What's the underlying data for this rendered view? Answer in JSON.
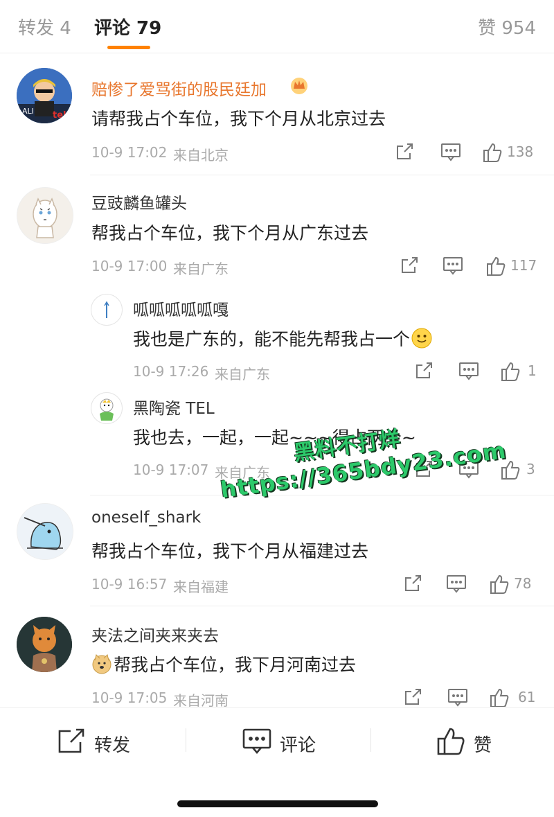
{
  "tabs": {
    "repost": "转发 4",
    "comments": "评论 79",
    "likes": "赞 954"
  },
  "comments": [
    {
      "user": "赔惨了爱骂街的股民廷加",
      "vip": true,
      "text": "请帮我占个车位，我下个月从北京过去",
      "time": "10-9 17:02",
      "location": "来自北京",
      "likes": "138"
    },
    {
      "user": "豆豉麟鱼罐头",
      "text": "帮我占个车位，我下个月从广东过去",
      "time": "10-9 17:00",
      "location": "来自广东",
      "likes": "117"
    },
    {
      "user": "呱呱呱呱呱嘎",
      "text": "我也是广东的，能不能先帮我占一个",
      "time": "10-9 17:26",
      "location": "来自广东",
      "likes": "1"
    },
    {
      "user": "黑陶瓷 TEL",
      "text": "我也去，一起，一起~~~得占两个~",
      "time": "10-9 17:07",
      "location": "来自广东",
      "likes": "3"
    },
    {
      "user": "oneself_shark",
      "text": "帮我占个车位，我下个月从福建过去",
      "time": "10-9 16:57",
      "location": "来自福建",
      "likes": "78"
    },
    {
      "user": "夹法之间夹来夹去",
      "text": "帮我占个车位，我下月河南过去",
      "time": "10-9 17:05",
      "location": "来自河南",
      "likes": "61"
    }
  ],
  "watermark": {
    "line1": "黑料不打烊",
    "line2": "https://365bdy23.com"
  },
  "bottom_bar": {
    "repost": "转发",
    "comment": "评论",
    "like": "赞"
  },
  "colors": {
    "accent": "#ff8200",
    "vip_name": "#e8772e",
    "watermark": "#2cc96a"
  },
  "icons": {
    "share": "share-icon",
    "comment": "comment-icon",
    "like": "thumbs-up-icon"
  }
}
